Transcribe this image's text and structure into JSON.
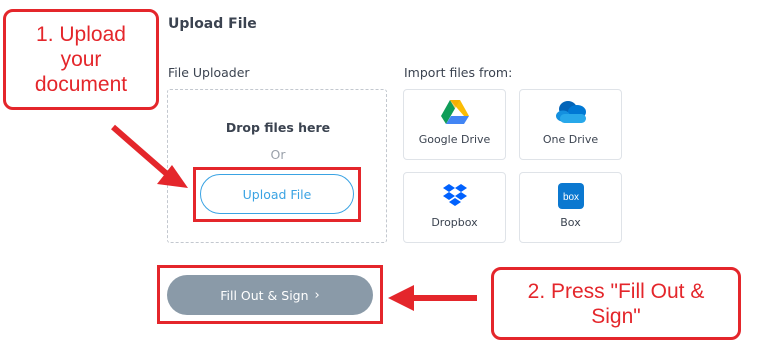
{
  "page": {
    "title": "Upload File"
  },
  "uploader": {
    "section_label": "File Uploader",
    "drop_text": "Drop files here",
    "or_text": "Or",
    "upload_button": "Upload File"
  },
  "import": {
    "section_label": "Import files from:",
    "sources": [
      {
        "label": "Google Drive",
        "icon": "google-drive-icon"
      },
      {
        "label": "One Drive",
        "icon": "onedrive-icon"
      },
      {
        "label": "Dropbox",
        "icon": "dropbox-icon"
      },
      {
        "label": "Box",
        "icon": "box-icon"
      }
    ]
  },
  "actions": {
    "fill_out_sign": "Fill Out & Sign",
    "chevron": "›"
  },
  "annotations": {
    "step1_lines": [
      "1. Upload",
      "your",
      "document"
    ],
    "step2_lines": [
      "2. Press \"Fill Out &",
      "Sign\""
    ],
    "accent_color": "#e4262b"
  },
  "colors": {
    "link_blue": "#3aa3e3",
    "button_gray": "#8a9aa8"
  }
}
